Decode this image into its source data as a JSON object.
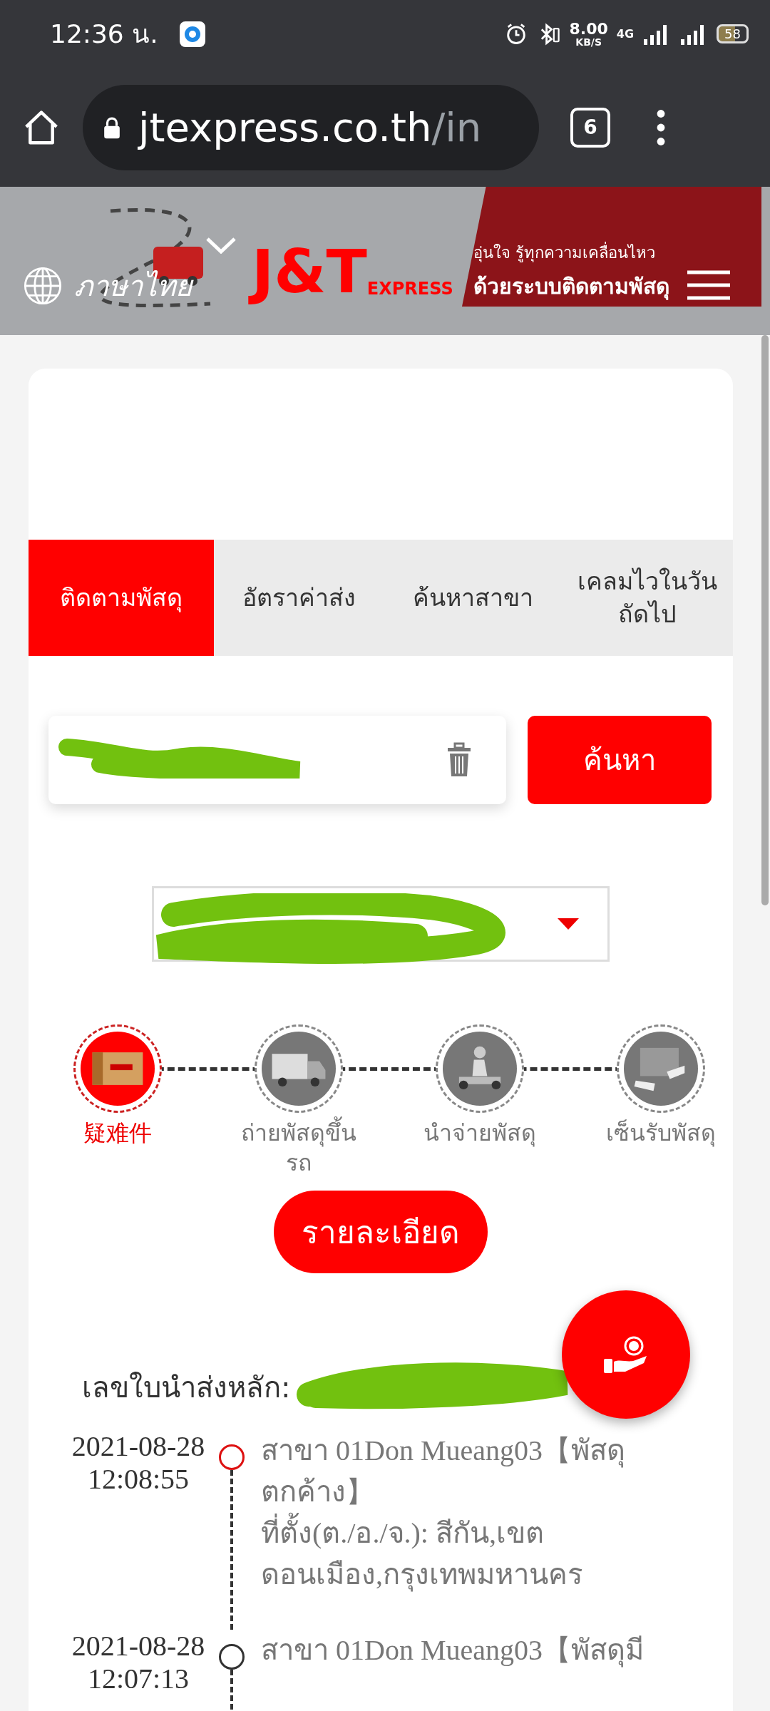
{
  "status_bar": {
    "time": "12:36 น.",
    "net_speed": "8.00",
    "net_unit": "KB/S",
    "network": "4G",
    "battery": "58"
  },
  "browser": {
    "url_host": "jtexpress.co.th",
    "url_path": "/in",
    "tab_count": "6"
  },
  "banner": {
    "language": "ภาษาไทย",
    "logo": "J&T",
    "logo_sub": "EXPRESS",
    "tagline": "อุ่นใจ รู้ทุกความเคลื่อนไหว",
    "headline": "ด้วยระบบติดตามพัสดุ"
  },
  "tabs": [
    {
      "label": "ติดตามพัสดุ",
      "selected": true
    },
    {
      "label": "อัตราค่าส่ง",
      "selected": false
    },
    {
      "label": "ค้นหาสาขา",
      "selected": false
    },
    {
      "label": "เคลมไวในวันถัดไป",
      "selected": false
    }
  ],
  "search": {
    "button": "ค้นหา"
  },
  "steps": [
    {
      "label": "疑难件",
      "kind": "box",
      "active": true
    },
    {
      "label": "ถ่ายพัสดุขึ้นรถ",
      "kind": "truck",
      "active": false
    },
    {
      "label": "นำจ่ายพัสดุ",
      "kind": "scooter",
      "active": false
    },
    {
      "label": "เซ็นรับพัสดุ",
      "kind": "handover",
      "active": false
    }
  ],
  "detail_button": "รายละเอียด",
  "waybill_label": "เลขใบนำส่งหลัก:",
  "events": [
    {
      "date": "2021-08-28",
      "time": "12:08:55",
      "current": true,
      "lines": [
        "สาขา 01Don Mueang03【พัสดุตกค้าง】",
        "ที่ตั้ง(ต./อ./จ.):  สีกัน,เขตดอนเมือง,กรุงเทพมหานคร"
      ]
    },
    {
      "date": "2021-08-28",
      "time": "12:07:13",
      "current": false,
      "lines": [
        "สาขา 01Don Mueang03【พัสดุมี"
      ]
    }
  ]
}
